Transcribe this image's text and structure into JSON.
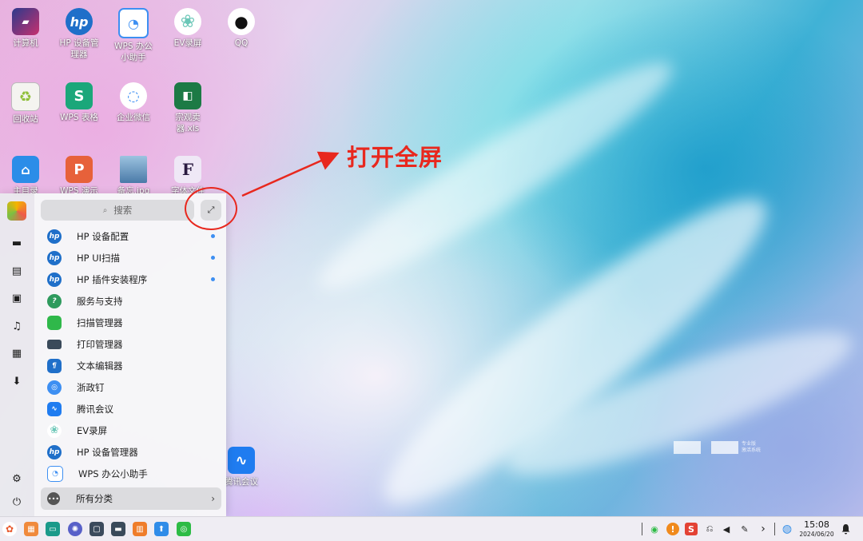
{
  "desktop": {
    "icons": [
      {
        "name": "computer",
        "label": "计算机",
        "icon": "computer-icon",
        "color": "#c7306f"
      },
      {
        "name": "hp-device-manager",
        "label": "HP 设备管\n理器",
        "icon": "hp-icon",
        "color": "#1f6fc9"
      },
      {
        "name": "wps-assistant",
        "label": "WPS 办公\n小助手",
        "icon": "wps-assistant-icon",
        "color": "#3d8ff2"
      },
      {
        "name": "ev-recorder",
        "label": "EV录屏",
        "icon": "ev-recorder-icon",
        "color": "#6cc7b8"
      },
      {
        "name": "qq",
        "label": "QQ",
        "icon": "qq-penguin-icon",
        "color": "#111111"
      },
      {
        "name": "recycle-bin",
        "label": "回收站",
        "icon": "recycle-bin-icon",
        "color": "#8fbf3a"
      },
      {
        "name": "wps-sheets",
        "label": "WPS 表格",
        "icon": "wps-sheets-icon",
        "color": "#1ba77a"
      },
      {
        "name": "wecom",
        "label": "企业微信",
        "icon": "wecom-icon",
        "color": "#3d8ff2"
      },
      {
        "name": "xlsx-file",
        "label": "宗观卖\n器.xls",
        "icon": "spreadsheet-file-icon",
        "color": "#1c7a45"
      },
      {
        "name": "home-folder",
        "label": "主目录",
        "icon": "home-folder-icon",
        "color": "#2b8de8"
      },
      {
        "name": "wps-presentation",
        "label": "WPS 演示",
        "icon": "wps-presentation-icon",
        "color": "#e7613a"
      },
      {
        "name": "image-file",
        "label": "备忘.jpg",
        "icon": "image-file-icon",
        "color": "#4a7aa8"
      },
      {
        "name": "font-file",
        "label": "字体文件",
        "icon": "font-file-icon",
        "color": "#8e6bc2"
      },
      {
        "name": "tencent-meeting-desk",
        "label": "腾讯会议",
        "icon": "tencent-meeting-icon",
        "color": "#1f7cf0"
      }
    ],
    "watermark": {
      "line1": "专业版",
      "line2": "激活系统"
    }
  },
  "annotation": {
    "text": "打开全屏",
    "color": "#e8281e"
  },
  "start_menu": {
    "search_placeholder": "搜索",
    "expand_icon": "fullscreen-expand-icon",
    "side_items": [
      {
        "name": "computer",
        "icon": "monitor-icon",
        "glyph": "▬"
      },
      {
        "name": "documents",
        "icon": "document-icon",
        "glyph": "▤"
      },
      {
        "name": "pictures",
        "icon": "image-icon",
        "glyph": "▣"
      },
      {
        "name": "music",
        "icon": "music-icon",
        "glyph": "♫"
      },
      {
        "name": "videos",
        "icon": "film-icon",
        "glyph": "▦"
      },
      {
        "name": "downloads",
        "icon": "download-icon",
        "glyph": "⬇"
      },
      {
        "name": "settings",
        "icon": "settings-icon",
        "glyph": "⚙"
      },
      {
        "name": "power",
        "icon": "power-icon",
        "glyph": "⏻"
      }
    ],
    "apps": [
      {
        "label": "HP 设备配置",
        "icon": "hp-icon",
        "color": "#1f6fc9",
        "glyph": "hp",
        "new": true
      },
      {
        "label": "HP UI扫描",
        "icon": "hp-icon",
        "color": "#1f6fc9",
        "glyph": "hp",
        "new": true
      },
      {
        "label": "HP 插件安装程序",
        "icon": "hp-icon",
        "color": "#1f6fc9",
        "glyph": "hp",
        "new": true
      },
      {
        "label": "服务与支持",
        "icon": "service-support-icon",
        "color": "#2e9a5d",
        "glyph": "?",
        "new": false
      },
      {
        "label": "扫描管理器",
        "icon": "scanner-icon",
        "color": "#2fb84a",
        "glyph": "",
        "new": false
      },
      {
        "label": "打印管理器",
        "icon": "printer-icon",
        "color": "#3a4a5a",
        "glyph": "",
        "new": false
      },
      {
        "label": "文本编辑器",
        "icon": "text-editor-icon",
        "color": "#1f6fc9",
        "glyph": "¶",
        "new": false
      },
      {
        "label": "浙政钉",
        "icon": "zhezhengding-icon",
        "color": "#3d8ff2",
        "glyph": "◎",
        "new": false
      },
      {
        "label": "腾讯会议",
        "icon": "tencent-meeting-icon",
        "color": "#1f7cf0",
        "glyph": "∿",
        "new": false
      },
      {
        "label": "EV录屏",
        "icon": "ev-recorder-icon",
        "color": "#6cc7b8",
        "glyph": "❀",
        "new": false
      },
      {
        "label": "HP 设备管理器",
        "icon": "hp-icon",
        "color": "#1f6fc9",
        "glyph": "hp",
        "new": false
      },
      {
        "label": "WPS 办公小助手",
        "icon": "wps-assistant-icon",
        "color": "#3d8ff2",
        "glyph": "◔",
        "new": false
      }
    ],
    "all_categories": "所有分类"
  },
  "taskbar": {
    "apps": [
      {
        "name": "launcher",
        "icon": "launcher-icon",
        "color": "#e8582c"
      },
      {
        "name": "app-store",
        "icon": "app-store-icon",
        "color": "#f08a3c"
      },
      {
        "name": "terminal",
        "icon": "terminal-icon",
        "color": "#1b9a8a"
      },
      {
        "name": "settings",
        "icon": "settings-gear-icon",
        "color": "#5860c8"
      },
      {
        "name": "monitor",
        "icon": "monitor-icon",
        "color": "#3b4a5c"
      },
      {
        "name": "printer",
        "icon": "printer-icon",
        "color": "#3a4a5a"
      },
      {
        "name": "archive",
        "icon": "archive-icon",
        "color": "#ef7d2a"
      },
      {
        "name": "app-center",
        "icon": "app-center-icon",
        "color": "#2f8ce8"
      },
      {
        "name": "wechat",
        "icon": "wechat-icon",
        "color": "#2dbb45"
      }
    ],
    "tray": [
      {
        "name": "wechat-tray",
        "icon": "wechat-icon",
        "glyph": "◉"
      },
      {
        "name": "alert-tray",
        "icon": "alert-icon",
        "glyph": "!"
      },
      {
        "name": "input-method",
        "icon": "sogou-input-icon",
        "glyph": "S"
      },
      {
        "name": "usb",
        "icon": "usb-icon",
        "glyph": "⎌"
      },
      {
        "name": "volume",
        "icon": "volume-icon",
        "glyph": "◀"
      },
      {
        "name": "pen",
        "icon": "pen-icon",
        "glyph": "✎"
      },
      {
        "name": "expand-tray",
        "icon": "chevron-right-icon",
        "glyph": "›"
      },
      {
        "name": "network",
        "icon": "network-globe-icon",
        "glyph": "◍"
      },
      {
        "name": "notifications",
        "icon": "bell-icon",
        "glyph": "🔔"
      }
    ],
    "clock": {
      "time": "15:08",
      "date": "2024/06/20"
    }
  }
}
